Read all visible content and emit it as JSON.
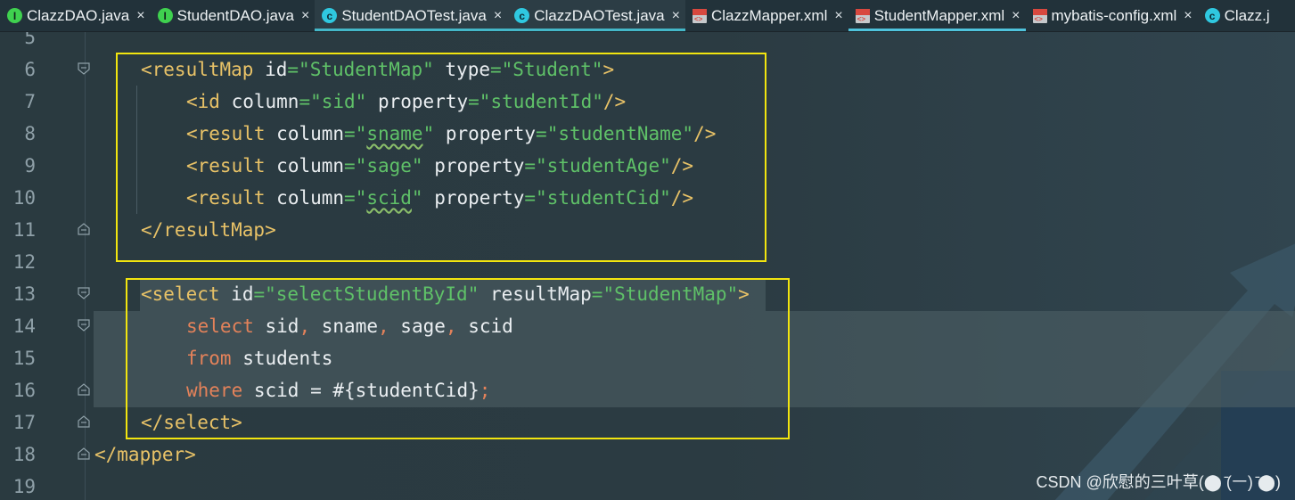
{
  "tabs": [
    {
      "label": "ClazzDAO.java",
      "icon": "interface-icon",
      "close": "×"
    },
    {
      "label": "StudentDAO.java",
      "icon": "interface-icon",
      "close": "×"
    },
    {
      "label": "StudentDAOTest.java",
      "icon": "class-icon",
      "close": "×"
    },
    {
      "label": "ClazzDAOTest.java",
      "icon": "class-icon",
      "close": "×"
    },
    {
      "label": "ClazzMapper.xml",
      "icon": "xml-icon",
      "close": "×"
    },
    {
      "label": "StudentMapper.xml",
      "icon": "xml-icon",
      "close": "×"
    },
    {
      "label": "mybatis-config.xml",
      "icon": "xml-icon",
      "close": "×"
    },
    {
      "label": "Clazz.j",
      "icon": "class-icon",
      "close": ""
    }
  ],
  "lines": [
    {
      "n": "5"
    },
    {
      "n": "6"
    },
    {
      "n": "7"
    },
    {
      "n": "8"
    },
    {
      "n": "9"
    },
    {
      "n": "10"
    },
    {
      "n": "11"
    },
    {
      "n": "12"
    },
    {
      "n": "13"
    },
    {
      "n": "14"
    },
    {
      "n": "15"
    },
    {
      "n": "16"
    },
    {
      "n": "17"
    },
    {
      "n": "18"
    },
    {
      "n": "19"
    }
  ],
  "code": {
    "l6": {
      "open": "<resultMap",
      "a1": "id",
      "eq": "=",
      "v1": "\"StudentMap\"",
      "a2": "type",
      "v2": "\"Student\"",
      "close": ">"
    },
    "l7": {
      "open": "<id",
      "a1": "column",
      "v1": "\"sid\"",
      "a2": "property",
      "v2": "\"studentId\"",
      "close": "/>"
    },
    "l8": {
      "open": "<result",
      "a1": "column",
      "q": "\"",
      "v1": "sname",
      "a2": "property",
      "v2": "\"studentName\"",
      "close": "/>"
    },
    "l9": {
      "open": "<result",
      "a1": "column",
      "v1": "\"sage\"",
      "a2": "property",
      "v2": "\"studentAge\"",
      "close": "/>"
    },
    "l10": {
      "open": "<result",
      "a1": "column",
      "v1": "scid",
      "a2": "property",
      "v2": "\"studentCid\"",
      "close": "/>"
    },
    "l11": {
      "text": "</resultMap>"
    },
    "l13": {
      "open": "<select",
      "a1": "id",
      "v1": "\"selectStudentById\"",
      "a2": "resultMap",
      "v2": "\"StudentMap\"",
      "close": ">"
    },
    "l14": {
      "kw": "select",
      "t1": "sid",
      "t2": "sname",
      "t3": "sage",
      "t4": "scid",
      "comma": ","
    },
    "l15": {
      "kw": "from",
      "t1": "students"
    },
    "l16": {
      "kw": "where",
      "t1": "scid = #{studentCid}",
      "semi": ";"
    },
    "l17": {
      "text": "</select>"
    },
    "l18": {
      "text": "</mapper>"
    }
  },
  "watermark": "CSDN @欣慰的三叶草(⬤ ̄(㇐) ̄⬤)",
  "colors": {
    "highlight_box": "#f2e50f",
    "tag": "#e8c267",
    "string": "#5fc168",
    "keyword": "#e4825a"
  }
}
